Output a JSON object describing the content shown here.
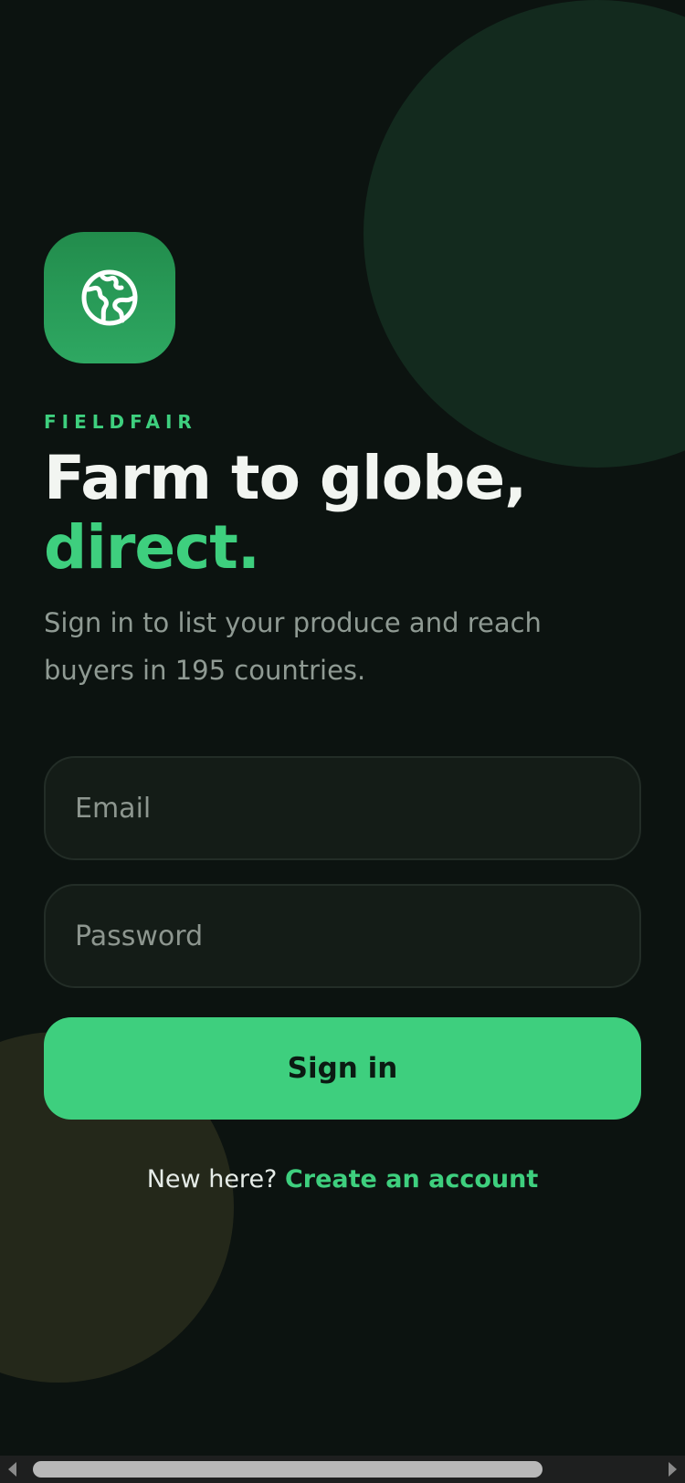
{
  "brand": {
    "name": "FIELDFAIR",
    "logo_icon": "globe-icon"
  },
  "hero": {
    "headline_line1": "Farm to globe,",
    "headline_line2": "direct.",
    "subtitle": "Sign in to list your produce and reach buyers in 195 countries."
  },
  "form": {
    "email": {
      "value": "",
      "placeholder": "Email"
    },
    "password": {
      "value": "",
      "placeholder": "Password"
    },
    "submit_label": "Sign in"
  },
  "signup": {
    "prompt": "New here?",
    "link_label": "Create an account"
  },
  "colors": {
    "background": "#0c1310",
    "accent": "#3ecf7e",
    "field_bg": "#141c17",
    "text_primary": "#f2f5f1",
    "text_muted": "#8f9a93"
  }
}
